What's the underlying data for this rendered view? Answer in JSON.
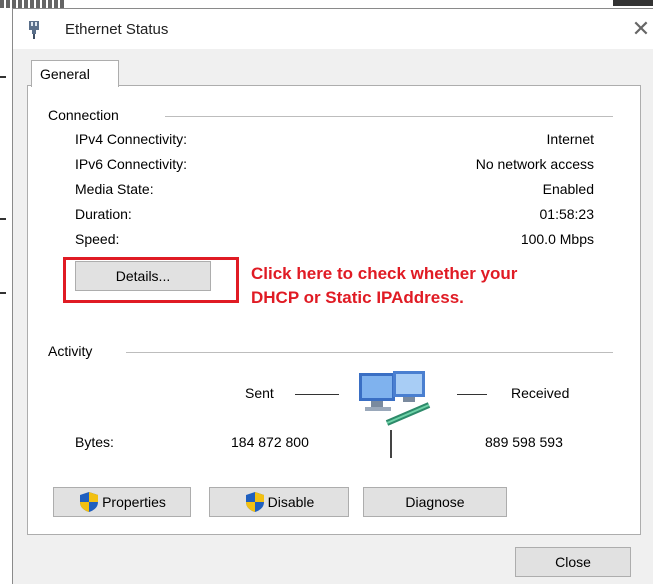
{
  "window": {
    "title": "Ethernet Status",
    "close_glyph": "✕"
  },
  "tabs": [
    {
      "label": "General",
      "active": true
    }
  ],
  "connection": {
    "group_label": "Connection",
    "rows": [
      {
        "label": "IPv4 Connectivity:",
        "value": "Internet"
      },
      {
        "label": "IPv6 Connectivity:",
        "value": "No network access"
      },
      {
        "label": "Media State:",
        "value": "Enabled"
      },
      {
        "label": "Duration:",
        "value": "01:58:23"
      },
      {
        "label": "Speed:",
        "value": "100.0 Mbps"
      }
    ],
    "details_button": "Details..."
  },
  "annotation": {
    "line1": "Click here to check whether your",
    "line2": "DHCP or Static IPAddress.",
    "color": "#e01b24"
  },
  "activity": {
    "group_label": "Activity",
    "sent_label": "Sent",
    "received_label": "Received",
    "bytes_label": "Bytes:",
    "bytes_sent": "184 872 800",
    "bytes_received": "889 598 593"
  },
  "buttons": {
    "properties": "Properties",
    "disable": "Disable",
    "diagnose": "Diagnose",
    "close": "Close"
  },
  "icons": {
    "title": "network-adapter-icon",
    "shield": "uac-shield-icon",
    "activity": "network-computers-icon"
  }
}
